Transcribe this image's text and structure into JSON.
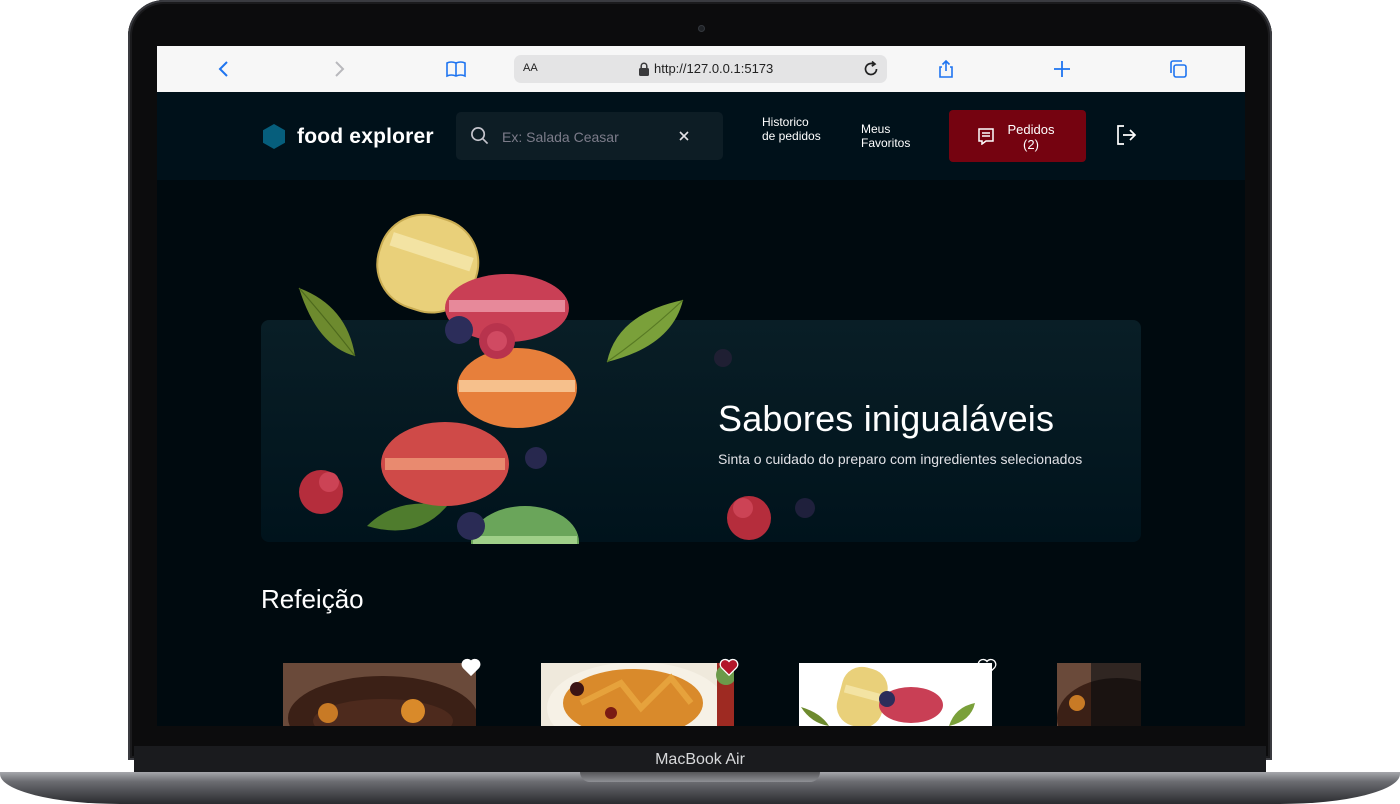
{
  "device": {
    "label": "MacBook Air"
  },
  "browser": {
    "text_size_label": "AA",
    "url": "http://127.0.0.1:5173"
  },
  "header": {
    "logo_text": "food explorer",
    "search_placeholder": "Ex: Salada Ceasar",
    "nav_history": "Historico de pedidos",
    "nav_favorites": "Meus Favoritos",
    "orders_label": "Pedidos (2)"
  },
  "banner": {
    "title": "Sabores inigualáveis",
    "subtitle": "Sinta o cuidado do preparo com ingredientes selecionados"
  },
  "meals": {
    "title": "Refeição",
    "cards": [
      {
        "favorite": false
      },
      {
        "favorite": true
      },
      {
        "favorite": false
      },
      {
        "favorite": false
      }
    ]
  },
  "colors": {
    "app_bg": "#000a0f",
    "header_bg": "#00111a",
    "accent_red": "#750310",
    "logo_blue": "#065e7c"
  }
}
